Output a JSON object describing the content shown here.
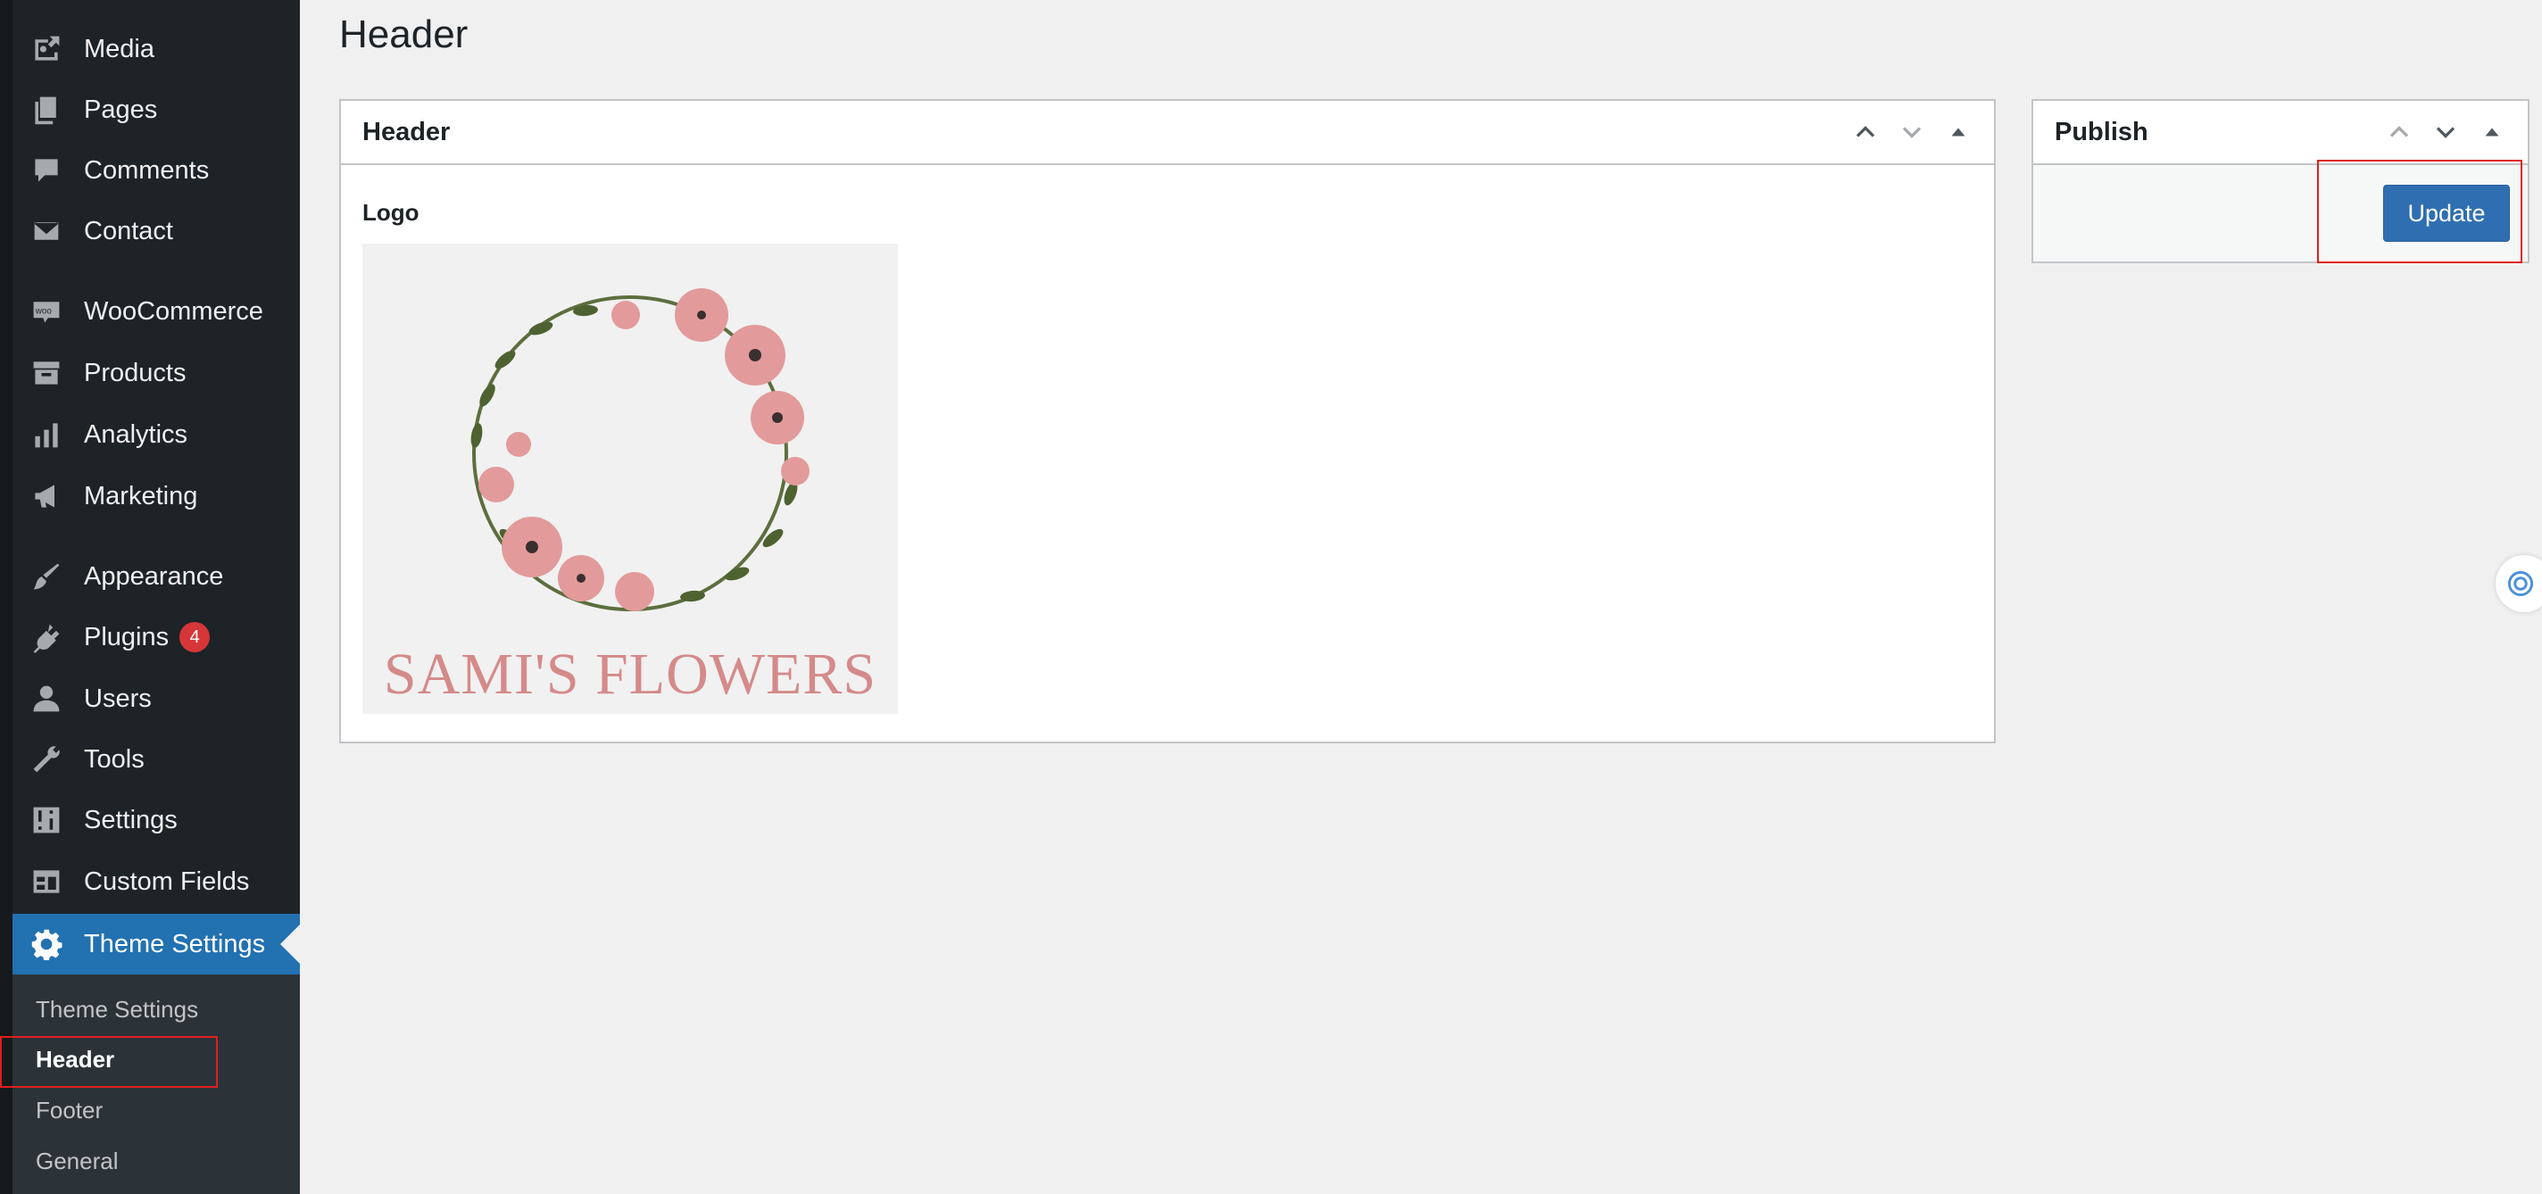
{
  "sidebar": {
    "items": [
      {
        "label": "Media",
        "icon": "media-icon"
      },
      {
        "label": "Pages",
        "icon": "pages-icon"
      },
      {
        "label": "Comments",
        "icon": "comments-icon"
      },
      {
        "label": "Contact",
        "icon": "envelope-icon"
      },
      {
        "label": "WooCommerce",
        "icon": "woocommerce-icon"
      },
      {
        "label": "Products",
        "icon": "archive-icon"
      },
      {
        "label": "Analytics",
        "icon": "bar-chart-icon"
      },
      {
        "label": "Marketing",
        "icon": "megaphone-icon"
      },
      {
        "label": "Appearance",
        "icon": "paintbrush-icon"
      },
      {
        "label": "Plugins",
        "icon": "plugin-icon",
        "badge": "4"
      },
      {
        "label": "Users",
        "icon": "user-icon"
      },
      {
        "label": "Tools",
        "icon": "wrench-icon"
      },
      {
        "label": "Settings",
        "icon": "sliders-icon"
      },
      {
        "label": "Custom Fields",
        "icon": "table-icon"
      },
      {
        "label": "Theme Settings",
        "icon": "gear-icon",
        "active": true
      }
    ],
    "submenu": [
      {
        "label": "Theme Settings"
      },
      {
        "label": "Header",
        "current": true
      },
      {
        "label": "Footer"
      },
      {
        "label": "General"
      }
    ]
  },
  "main": {
    "page_title": "Header",
    "header_box": {
      "title": "Header",
      "field_label": "Logo",
      "logo_text": "SAMI'S FLOWERS"
    },
    "publish_box": {
      "title": "Publish",
      "update_label": "Update"
    }
  },
  "colors": {
    "sidebar_bg": "#1d2327",
    "active_bg": "#2271b1",
    "button_bg": "#2f6fb1",
    "badge_bg": "#d63638",
    "annotation_red": "#e01e1e"
  }
}
